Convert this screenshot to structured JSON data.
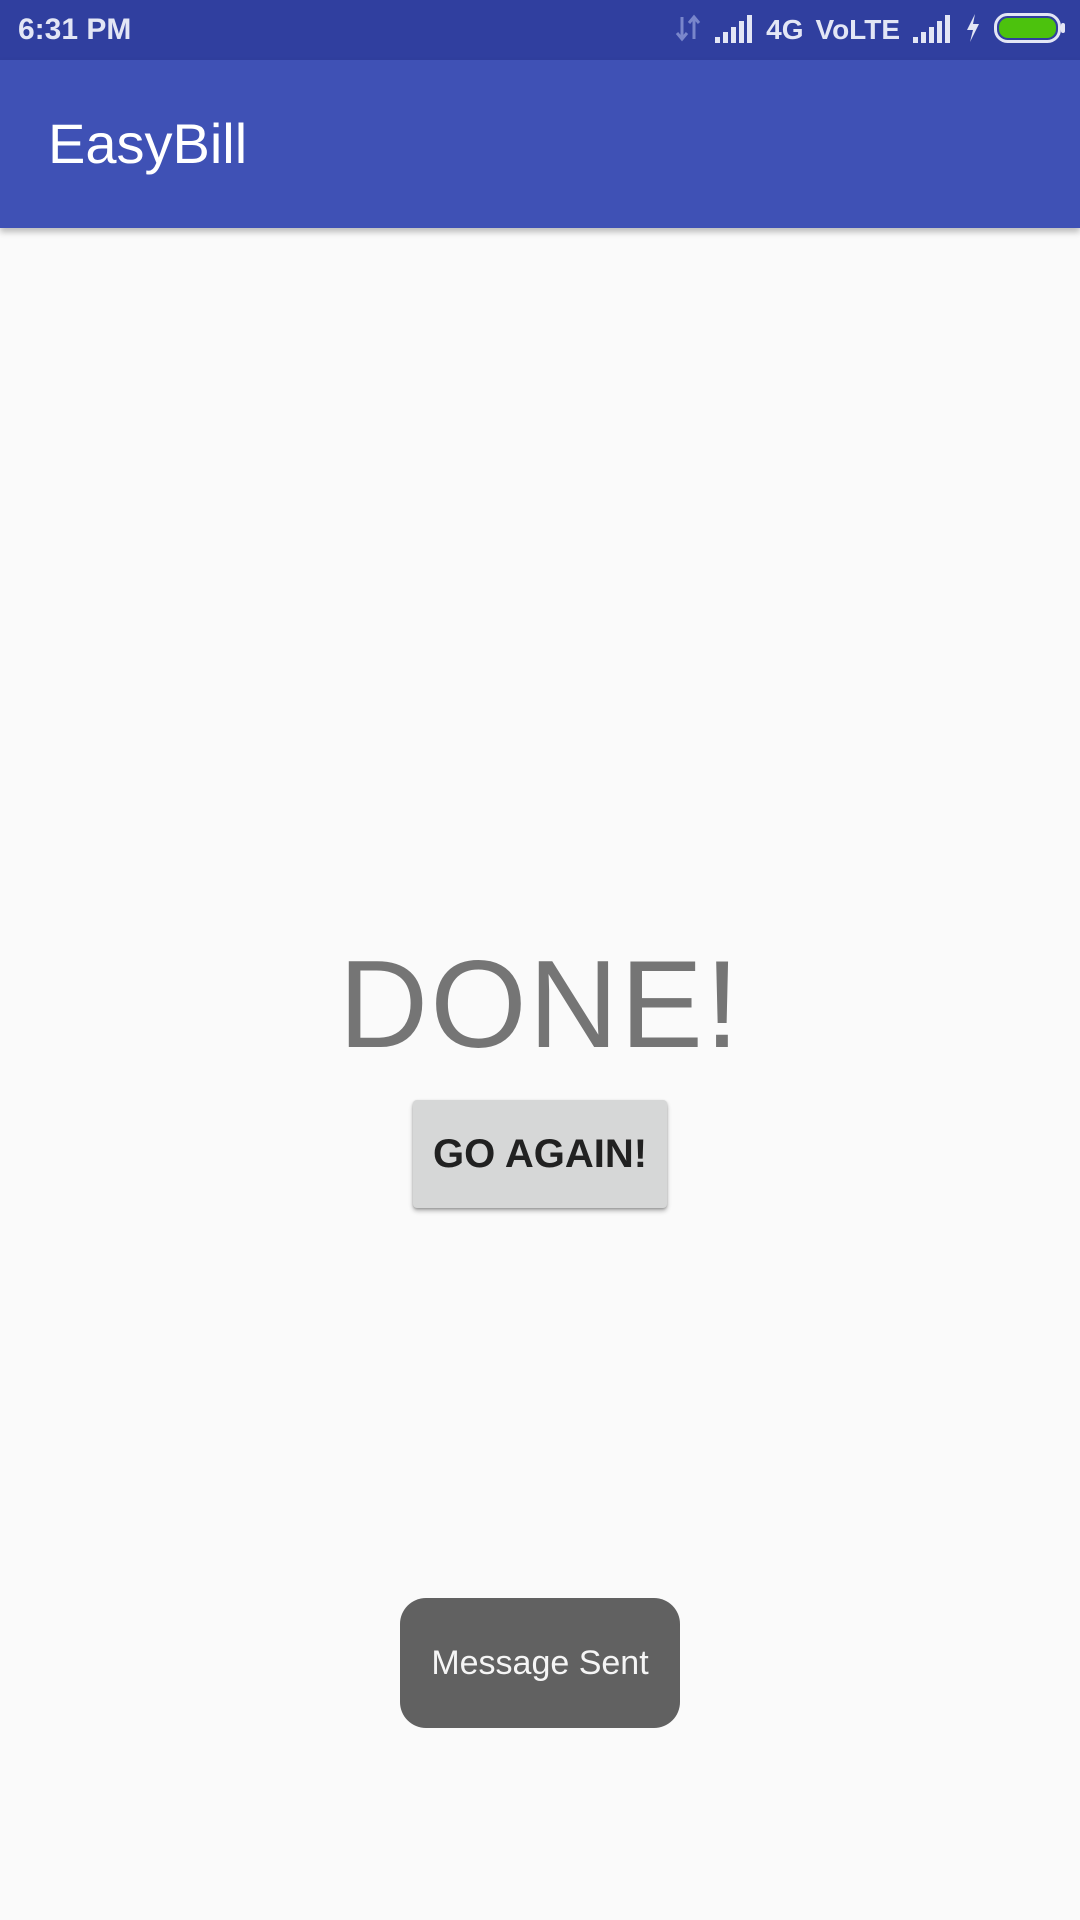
{
  "status_bar": {
    "time": "6:31 PM",
    "network_type": "4G",
    "volte": "VoLTE",
    "icons": [
      "data-arrows-icon",
      "signal-bars-icon",
      "signal-bars-icon",
      "charging-bolt-icon",
      "battery-icon"
    ],
    "battery_color": "#4cc20d"
  },
  "app_bar": {
    "title": "EasyBill",
    "color": "#3f51b5"
  },
  "main": {
    "done_text": "DONE!",
    "go_again_label": "GO AGAIN!"
  },
  "toast": {
    "message": "Message Sent"
  }
}
